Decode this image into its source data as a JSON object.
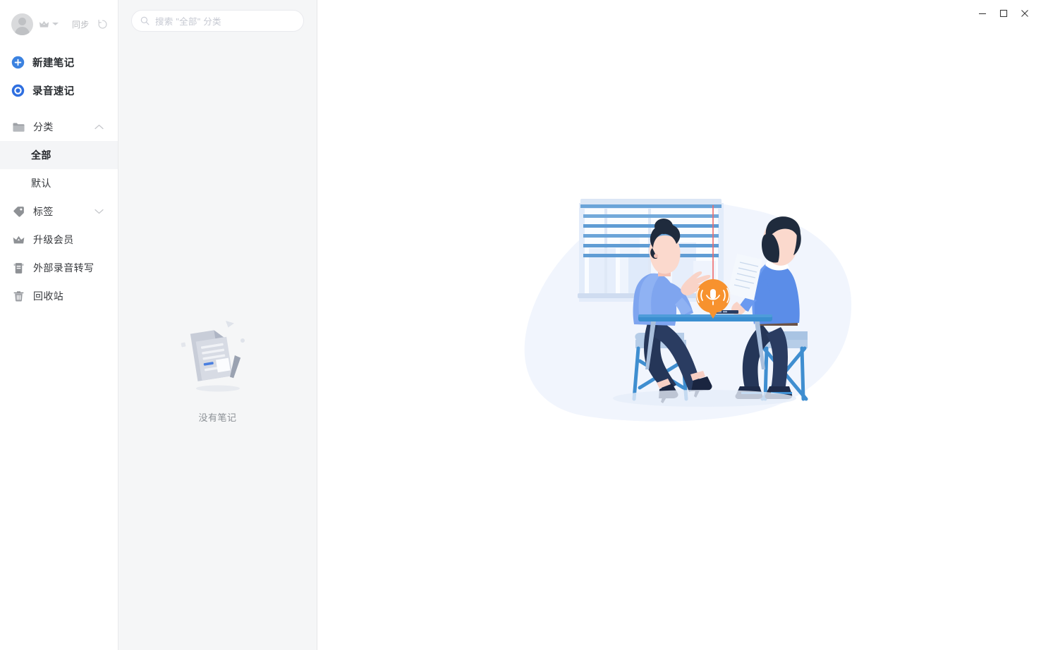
{
  "window": {
    "controls": [
      {
        "name": "minimize",
        "glyph": "minimize-icon"
      },
      {
        "name": "maximize",
        "glyph": "maximize-icon"
      },
      {
        "name": "close",
        "glyph": "close-icon"
      }
    ]
  },
  "sidebar": {
    "account": {
      "avatar_alt": "user-avatar",
      "crown_icon": "crown-icon",
      "dropdown_icon": "chevron-down-icon",
      "sync_label": "同步",
      "sync_icon": "sync-refresh-icon"
    },
    "primary_actions": [
      {
        "label": "新建笔记",
        "icon": "plus-circle-icon",
        "color": "#3b82e0"
      },
      {
        "label": "录音速记",
        "icon": "record-circle-icon",
        "color": "#2f6fe0"
      }
    ],
    "groups": [
      {
        "label": "分类",
        "icon": "folder-icon",
        "chevron": "chevron-up-icon",
        "expanded": true,
        "children": [
          {
            "label": "全部",
            "active": true
          },
          {
            "label": "默认",
            "active": false
          }
        ]
      }
    ],
    "items": [
      {
        "label": "标签",
        "icon": "tag-icon",
        "chevron": "chevron-down-icon"
      },
      {
        "label": "升级会员",
        "icon": "crown-icon",
        "chevron": ""
      },
      {
        "label": "外部录音转写",
        "icon": "transcribe-doc-icon",
        "chevron": ""
      },
      {
        "label": "回收站",
        "icon": "trash-icon",
        "chevron": ""
      }
    ]
  },
  "list_panel": {
    "search": {
      "icon": "search-icon",
      "placeholder": "搜索 \"全部\" 分类",
      "value": ""
    },
    "empty_state": {
      "illustration": "empty-note-document-illustration",
      "text": "没有笔记"
    }
  },
  "main": {
    "illustration": {
      "name": "two-people-recording-meeting-illustration",
      "elements": [
        "background-blob",
        "window-with-blinds",
        "city-skyline",
        "woman-seated",
        "man-seated-with-paper",
        "desk",
        "recording-mic-badge",
        "hanging-cord"
      ],
      "badge_icon": "microphone-waves-icon"
    }
  },
  "colors": {
    "accent_blue": "#3b82e0",
    "sidebar_bg": "#ffffff",
    "list_bg": "#f5f6f7",
    "main_bg": "#ffffff",
    "active_item_bg": "#f4f5f7",
    "blob": "#f1f5fd",
    "badge_orange": "#f5922f",
    "desk_blue": "#3a8ed0"
  }
}
